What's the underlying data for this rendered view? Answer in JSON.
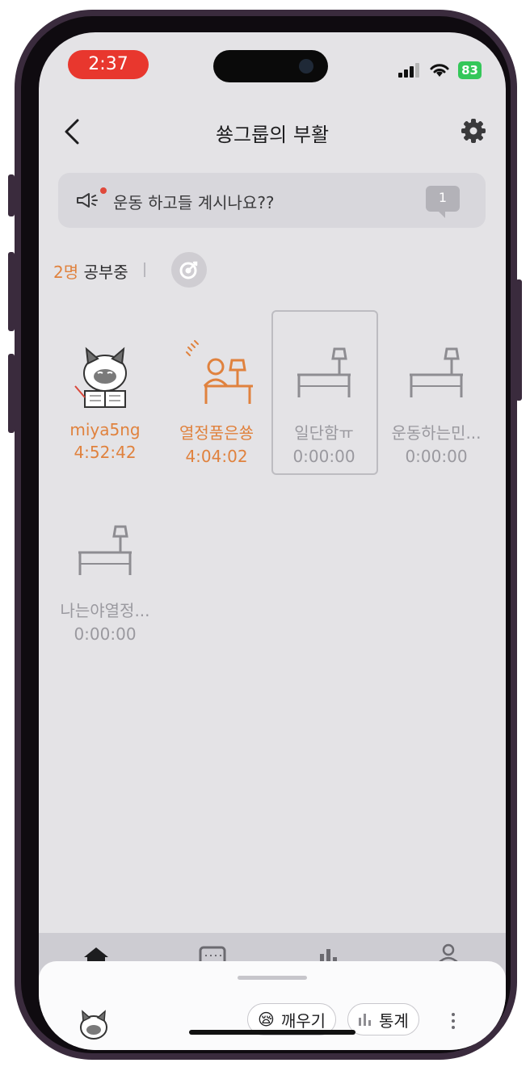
{
  "status_bar": {
    "time": "2:37",
    "battery": "83"
  },
  "header": {
    "title": "쑝그룹의 부활"
  },
  "notice": {
    "text": "운동 하고들 계시나요??",
    "comment_count": "1"
  },
  "studying": {
    "count": "2명",
    "label": "공부중"
  },
  "members": [
    {
      "name": "miya5ng",
      "time": "4:52:42",
      "state": "active",
      "avatar": "cat-reading"
    },
    {
      "name": "열정품은쑝",
      "time": "4:04:02",
      "state": "active",
      "avatar": "person-at-desk"
    },
    {
      "name": "일단함ㅠ",
      "time": "0:00:00",
      "state": "idle",
      "avatar": "empty-desk",
      "selected": true
    },
    {
      "name": "운동하는민...",
      "time": "0:00:00",
      "state": "idle",
      "avatar": "empty-desk"
    },
    {
      "name": "나는야열정...",
      "time": "0:00:00",
      "state": "idle",
      "avatar": "empty-desk"
    }
  ],
  "bottom_sheet": {
    "wake_label": "깨우기",
    "wake_emoji": "😪",
    "stats_label": "통계"
  },
  "colors": {
    "active": "#e0823e",
    "idle": "#9a999f",
    "accent_red": "#e8372e"
  }
}
